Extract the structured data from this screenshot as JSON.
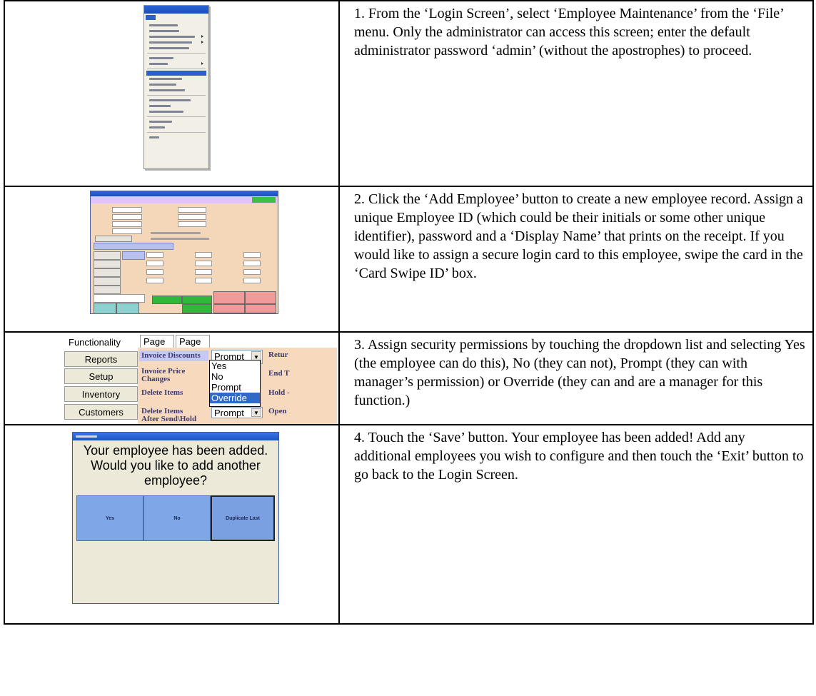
{
  "steps": [
    {
      "text": "1.  From the ‘Login Screen’, select ‘Employee Maintenance’ from the ‘File’ menu.  Only the administrator can access this screen; enter the default administrator password ‘admin’ (without the apostrophes) to proceed."
    },
    {
      "text": "2.  Click the ‘Add Employee’ button to create a new employee record. Assign a unique Employee ID (which could be their initials or some other unique identifier), password and a ‘Display Name’ that prints on the receipt.  If you would like to assign a secure login card to this employee, swipe the card in the ‘Card Swipe ID’ box."
    },
    {
      "text": "3. Assign security permissions by touching the dropdown list and selecting Yes (the employee can do this), No (they can not), Prompt (they can with manager’s permission) or Override (they can and are a manager for this function.)"
    },
    {
      "text": "4. Touch the ‘Save’ button.  Your employee has been added! Add any additional employees you wish to configure and then touch the ‘Exit’ button to go back to the Login Screen."
    }
  ],
  "permissions": {
    "sidebar": [
      "Functionality",
      "Reports",
      "Setup",
      "Inventory",
      "Customers"
    ],
    "tabs": [
      "Page 1",
      "Page 2"
    ],
    "rows": [
      {
        "label_line1": "Invoice Discounts",
        "label_line2": ""
      },
      {
        "label_line1": "Invoice Price",
        "label_line2": "Changes"
      },
      {
        "label_line1": "Delete Items",
        "label_line2": ""
      },
      {
        "label_line1": "Delete Items",
        "label_line2": "After Send\\Hold"
      }
    ],
    "combo_value": "Prompt",
    "combo_value_bottom": "Prompt",
    "options": [
      "Yes",
      "No",
      "Prompt",
      "Override"
    ],
    "selected_option": "Override",
    "right_labels": [
      "Retur",
      "End T",
      "Hold -",
      "Open"
    ]
  },
  "dialog": {
    "message_lines": [
      "Your employee has been added.",
      "Would you like to add another",
      "employee?"
    ],
    "buttons": [
      "Yes",
      "No",
      "Duplicate Last"
    ]
  },
  "colors": {
    "titlebar": "#1d54c2",
    "selection": "#316ac5",
    "perm_background": "#f7d9bd",
    "dialog_button": "#7fa6e6"
  }
}
